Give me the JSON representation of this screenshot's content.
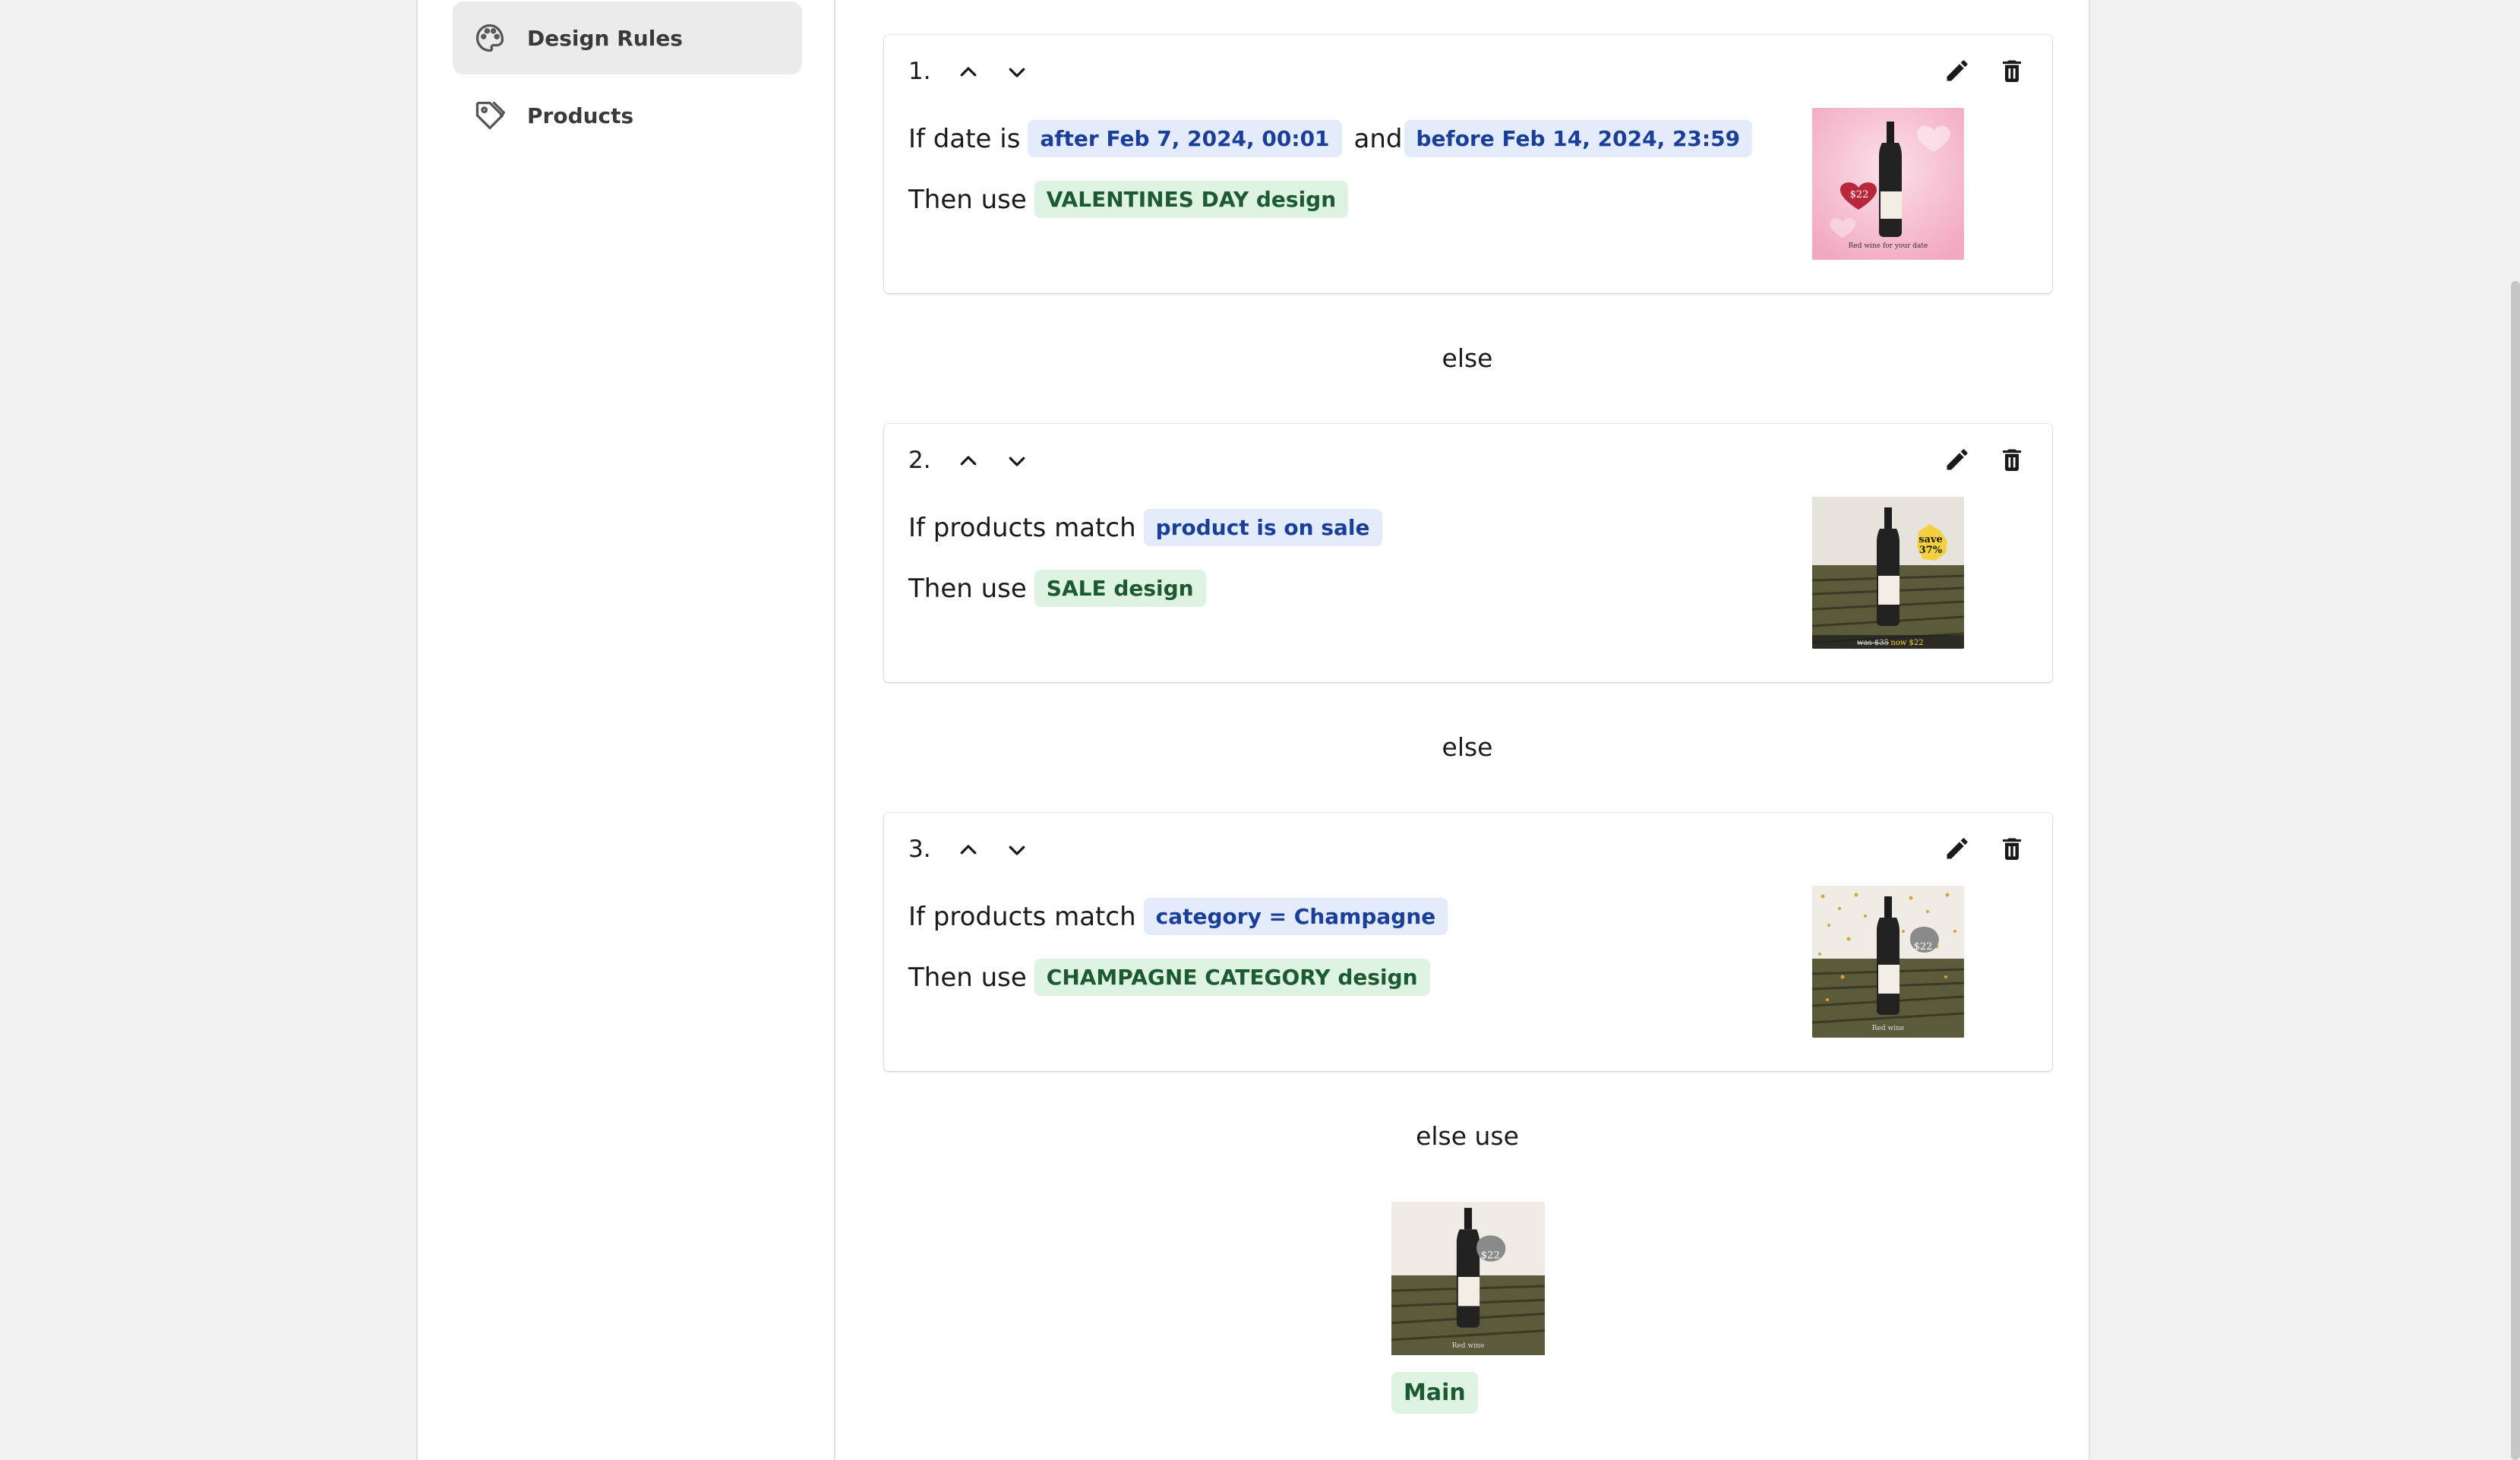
{
  "sidebar": {
    "items": [
      {
        "label": "Design Rules",
        "icon": "palette-icon",
        "active": true
      },
      {
        "label": "Products",
        "icon": "tag-icon",
        "active": false
      }
    ]
  },
  "rules": [
    {
      "number": "1.",
      "condition_prefix": "If date is",
      "condition_tags": [
        "after Feb 7, 2024, 00:01",
        "before Feb 14, 2024, 23:59"
      ],
      "joiner": "and",
      "action_prefix": "Then use",
      "design": "VALENTINES DAY design",
      "preview": {
        "price": "$22",
        "caption": "Red wine for your date"
      }
    },
    {
      "number": "2.",
      "condition_prefix": "If products match",
      "condition_tags": [
        "product is on sale"
      ],
      "action_prefix": "Then use",
      "design": "SALE design",
      "preview": {
        "badge_line1": "save",
        "badge_line2": "37%",
        "was": "was $35",
        "now": "now $22"
      }
    },
    {
      "number": "3.",
      "condition_prefix": "If products match",
      "condition_tags": [
        "category = Champagne"
      ],
      "action_prefix": "Then use",
      "design": "CHAMPAGNE CATEGORY design",
      "preview": {
        "price": "$22",
        "caption": "Red wine"
      }
    }
  ],
  "separators": {
    "else": "else",
    "else_use": "else use"
  },
  "default_design": {
    "label": "Main",
    "price": "$22",
    "caption": "Red wine"
  },
  "colors": {
    "blue_tag_bg": "#e4ecfb",
    "blue_tag_text": "#1a3f99",
    "green_tag_bg": "#dff3e3",
    "green_tag_text": "#1c5b32"
  }
}
